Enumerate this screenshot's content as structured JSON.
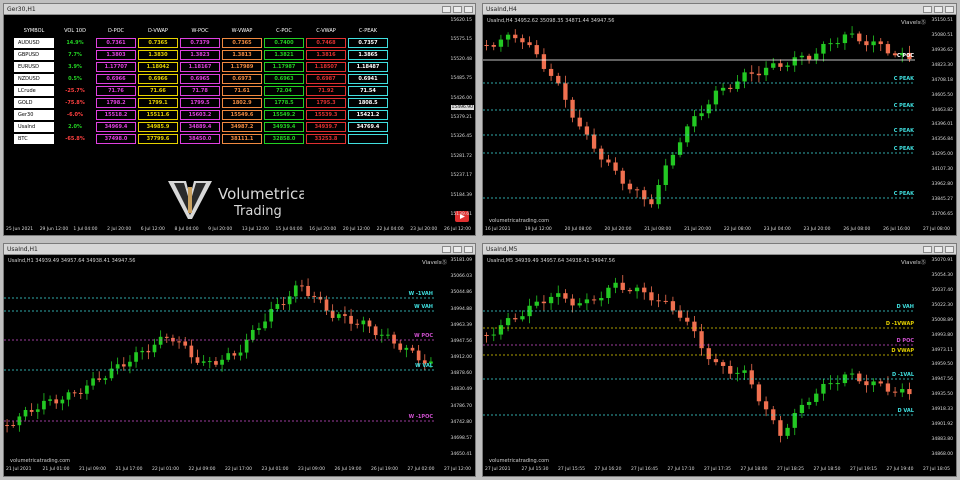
{
  "windows": {
    "w1": {
      "title": "Ger30,H1"
    },
    "w2": {
      "title": "UsaInd,H4",
      "symbol_line": "UsaInd,H4  34952.62  35098.35  34871.44  34947.56",
      "vizlabel": "ViavelsⓈ",
      "website": "volumetricatrading.com",
      "prices": [
        "35150.51",
        "35080.51",
        "34936.62",
        "34823.30",
        "34708.18",
        "34605.50",
        "34463.82",
        "34396.01",
        "34356.84",
        "34295.00",
        "34107.30",
        "33962.80",
        "33845.27",
        "33706.65"
      ],
      "dates": [
        "16 Jul 2021",
        "19 Jul 12:00",
        "20 Jul 08:00",
        "20 Jul 20:00",
        "21 Jul 08:00",
        "21 Jul 20:00",
        "22 Jul 08:00",
        "23 Jul 04:00",
        "23 Jul 20:00",
        "26 Jul 08:00",
        "26 Jul 16:00",
        "27 Jul 08:00"
      ],
      "levels": [
        {
          "label": "C POC",
          "color": "#ffffff"
        },
        {
          "label": "C PEAK",
          "color": "#40e0e0"
        },
        {
          "label": "C PEAK",
          "color": "#40e0e0"
        },
        {
          "label": "C PEAK",
          "color": "#40e0e0"
        },
        {
          "label": "C PEAK",
          "color": "#40e0e0"
        },
        {
          "label": "C PEAK",
          "color": "#40e0e0"
        }
      ]
    },
    "w3": {
      "title": "UsaInd,H1",
      "symbol_line": "UsaInd,H1  34939.49  34957.64  34938.41  34947.56",
      "vizlabel": "ViavelsⓈ",
      "website": "volumetricatrading.com",
      "prices": [
        "35181.09",
        "35066.03",
        "35044.86",
        "34994.88",
        "34963.39",
        "34947.56",
        "34912.00",
        "34878.60",
        "34830.49",
        "34786.70",
        "34742.80",
        "34698.57",
        "34650.41"
      ],
      "dates": [
        "21 Jul 2021",
        "21 Jul 01:00",
        "21 Jul 09:00",
        "21 Jul 17:00",
        "22 Jul 01:00",
        "22 Jul 09:00",
        "22 Jul 17:00",
        "23 Jul 01:00",
        "23 Jul 09:00",
        "26 Jul 19:00",
        "26 Jul 19:00",
        "27 Jul 02:00",
        "27 Jul 12:00"
      ],
      "levels": [
        {
          "label": "W -1VAH",
          "color": "#40e0e0"
        },
        {
          "label": "W VAH",
          "color": "#40e0e0"
        },
        {
          "label": "W POC",
          "color": "#d050d0"
        },
        {
          "label": "W VAL",
          "color": "#40e0e0"
        },
        {
          "label": "W -1POC",
          "color": "#d050d0"
        }
      ]
    },
    "w4": {
      "title": "UsaInd,M5",
      "symbol_line": "UsaInd,M5  34939.49  34957.64  34938.41  34947.56",
      "vizlabel": "ViavelsⓈ",
      "website": "volumetricatrading.com",
      "prices": [
        "35070.91",
        "35054.30",
        "35037.40",
        "35022.30",
        "35008.89",
        "34993.80",
        "34973.11",
        "34959.50",
        "34947.56",
        "34935.50",
        "34918.33",
        "34901.92",
        "34883.80",
        "34868.00"
      ],
      "dates": [
        "27 Jul 2021",
        "27 Jul 15:30",
        "27 Jul 15:55",
        "27 Jul 16:20",
        "27 Jul 16:45",
        "27 Jul 17:10",
        "27 Jul 17:35",
        "27 Jul 18:00",
        "27 Jul 18:25",
        "27 Jul 18:50",
        "27 Jul 19:15",
        "27 Jul 19:40",
        "27 Jul 18:05"
      ],
      "levels": [
        {
          "label": "D VAH",
          "color": "#40e0e0"
        },
        {
          "label": "D -1VWAP",
          "color": "#e6d200"
        },
        {
          "label": "D POC",
          "color": "#d050d0"
        },
        {
          "label": "D VWAP",
          "color": "#e6d200"
        },
        {
          "label": "D -1VAL",
          "color": "#40e0e0"
        },
        {
          "label": "D VAL",
          "color": "#40e0e0"
        }
      ]
    }
  },
  "ger30": {
    "prices": [
      "15620.15",
      "15575.15",
      "15520.48",
      "15485.75",
      "15426.00",
      "15379.21",
      "15326.45",
      "15281.72",
      "15237.17",
      "15184.39",
      "15139.61"
    ],
    "price_tag": "15496.90",
    "dates": [
      "25 Jun 2021",
      "29 Jun 12:00",
      "1 Jul 04:00",
      "2 Jul 20:00",
      "6 Jul 12:00",
      "8 Jul 04:00",
      "9 Jul 20:00",
      "13 Jul 12:00",
      "15 Jul 04:00",
      "16 Jul 20:00",
      "20 Jul 12:00",
      "22 Jul 04:00",
      "23 Jul 20:00",
      "26 Jul 12:00"
    ],
    "logo_title": "Volumetrica",
    "logo_sub": "Trading",
    "table": {
      "headers": [
        "SYMBOL",
        "VOL 10D",
        "D-POC",
        "D-VWAP",
        "W-POC",
        "W-VWAP",
        "C-POC",
        "C-VWAP",
        "C-PEAK"
      ],
      "rows": [
        {
          "s": "AUDUSD",
          "v": "14.9%",
          "vc": "#23d023",
          "c": [
            "0.7361",
            "0.7365",
            "0.7379",
            "0.7365",
            "0.7400",
            "0.7468",
            "0.7357"
          ]
        },
        {
          "s": "GBPUSD",
          "v": "7.7%",
          "vc": "#23d023",
          "c": [
            "1.3803",
            "1.3830",
            "1.3823",
            "1.3813",
            "1.3821",
            "1.3816",
            "1.3865"
          ]
        },
        {
          "s": "EURUSD",
          "v": "3.9%",
          "vc": "#23d023",
          "c": [
            "1.17707",
            "1.18042",
            "1.18167",
            "1.17989",
            "1.17987",
            "1.18507",
            "1.18487"
          ]
        },
        {
          "s": "NZDUSD",
          "v": "0.5%",
          "vc": "#23d023",
          "c": [
            "0.6966",
            "0.6966",
            "0.6965",
            "0.6973",
            "0.6963",
            "0.6987",
            "0.6941"
          ]
        },
        {
          "s": "LCrude",
          "v": "-25.7%",
          "vc": "#ff4040",
          "c": [
            "71.76",
            "71.66",
            "71.78",
            "71.61",
            "72.04",
            "71.92",
            "71.54"
          ]
        },
        {
          "s": "GOLD",
          "v": "-75.8%",
          "vc": "#ff4040",
          "c": [
            "1798.2",
            "1799.1",
            "1799.5",
            "1802.9",
            "1778.5",
            "1795.3",
            "1808.5"
          ]
        },
        {
          "s": "Ger30",
          "v": "-6.0%",
          "vc": "#ff4040",
          "c": [
            "15518.2",
            "15511.6",
            "15603.2",
            "15549.6",
            "15549.2",
            "15539.3",
            "15421.2"
          ]
        },
        {
          "s": "UsaInd",
          "v": "2.0%",
          "vc": "#23d023",
          "c": [
            "34969.4",
            "34985.9",
            "34889.4",
            "34987.2",
            "34939.4",
            "34939.7",
            "34769.4"
          ]
        },
        {
          "s": "BTC",
          "v": "-65.8%",
          "vc": "#ff4040",
          "c": [
            "37498.0",
            "37799.6",
            "38450.0",
            "38111.1",
            "32858.0",
            "33253.8",
            ""
          ]
        }
      ],
      "col_colors": [
        {
          "border": "#e040e0",
          "text": "#e040e0"
        },
        {
          "border": "#e6d200",
          "text": "#e6d200"
        },
        {
          "border": "#e040e0",
          "text": "#e040e0"
        },
        {
          "border": "#f08a40",
          "text": "#f08a40"
        },
        {
          "border": "#23d023",
          "text": "#23d023"
        },
        {
          "border": "#e03030",
          "text": "#e03030"
        },
        {
          "border": "#40e0e0",
          "text": "#ffffff"
        }
      ]
    }
  }
}
